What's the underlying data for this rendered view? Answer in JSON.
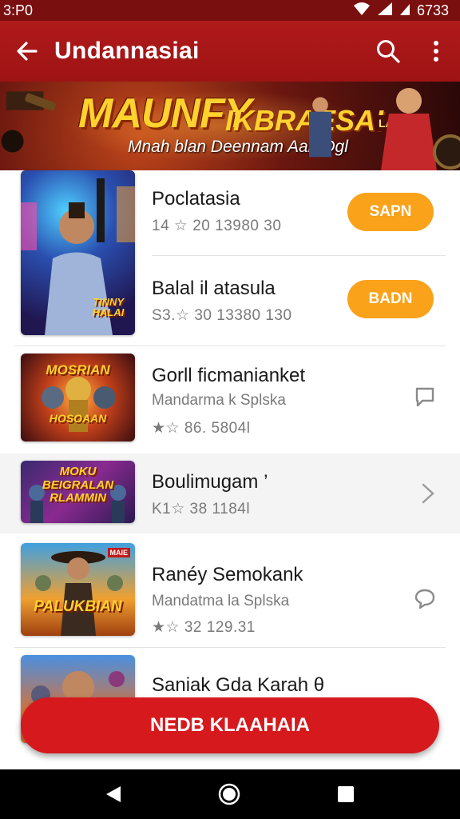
{
  "status_bar": {
    "time": "3:P0",
    "battery": "6733"
  },
  "app_bar": {
    "title": "Undannasiai"
  },
  "banner": {
    "title_line1": "MAUNFY",
    "title_line2": "IKBRAESAI",
    "badge": "LAWAE",
    "subtitle": "Mnah blan Deennam Aah Ogl"
  },
  "items": [
    {
      "title": "Poclatasia",
      "meta": "14 ☆   20  13980  30",
      "button": "SAPN",
      "thumb_text": "TINNY HALAI"
    },
    {
      "title": "Balal il atasula",
      "meta": "S3.☆   30  13380  130",
      "button": "BADN"
    },
    {
      "title": "Gorll ficmanianket",
      "subtitle": "Mandarma  k Splska",
      "meta": "★☆   86.  5804l",
      "thumb_text_top": "MOSRIAN",
      "thumb_text_bottom": "HOSOAAN"
    },
    {
      "title": "Boulimugam ’",
      "meta": "K1☆   38  1184l",
      "thumb_text": "MOKU BEIGRALAN RLAMMIN"
    },
    {
      "title": "Ranéy Semokank",
      "subtitle": "Mandatma  la Splska",
      "meta": "★☆   32  129.31",
      "thumb_text": "PALUKBIAN",
      "thumb_badge": "MAIE"
    },
    {
      "title": "Saniak Gda Karah θ"
    }
  ],
  "cta": {
    "label": "NEDB KLAAHAIA"
  },
  "colors": {
    "primary": "#b01a1b",
    "accent": "#f9a21a",
    "cta": "#d6191d"
  }
}
